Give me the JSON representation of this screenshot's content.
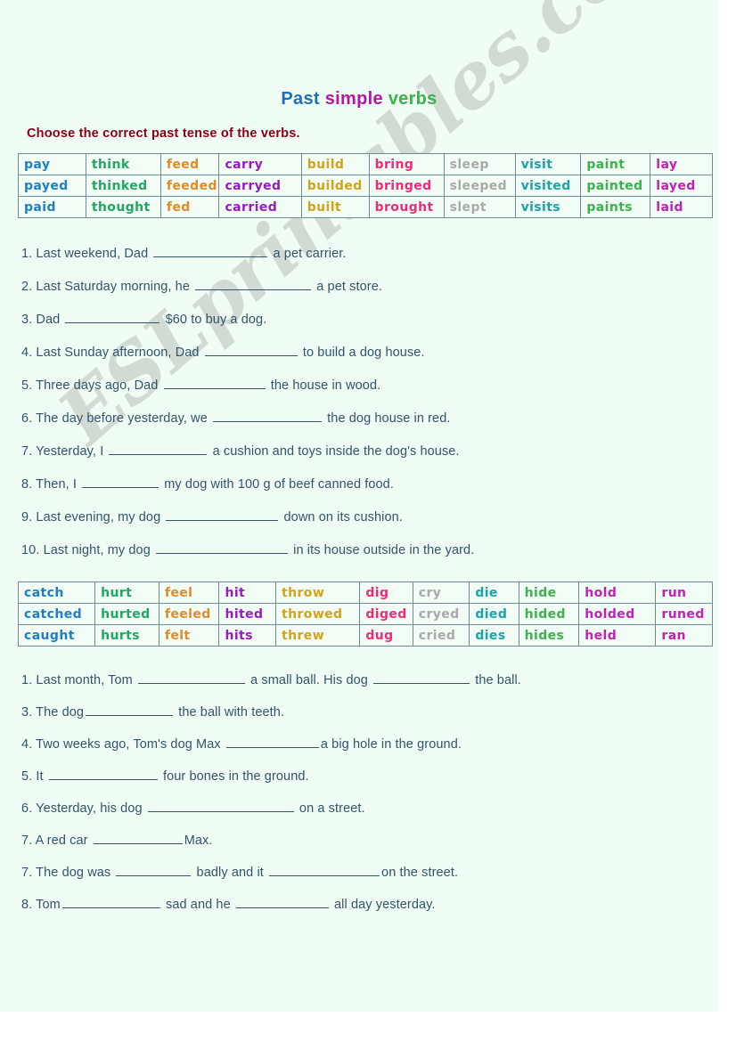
{
  "page": {
    "background_color": "#effdf4",
    "watermark": "ESLprintables.com"
  },
  "title": {
    "part1": "Past ",
    "part2": "simple ",
    "part3": "verbs",
    "color1": "#1f6fb8",
    "color2": "#b8159e",
    "color3": "#3ab34a"
  },
  "instruction": {
    "text": "Choose the correct past tense of the verbs.",
    "color": "#8c0016"
  },
  "table1": {
    "colors": [
      "#1f7fc4",
      "#1fa862",
      "#e08a2a",
      "#9b19c4",
      "#d2a316",
      "#ee2b7b",
      "#a9a9a9",
      "#1aa3a8",
      "#3ab34a",
      "#c41fb8"
    ],
    "widths": [
      74,
      82,
      64,
      90,
      74,
      82,
      78,
      72,
      76,
      68
    ],
    "rows": [
      [
        "pay",
        "think",
        "feed",
        "carry",
        "build",
        "bring",
        "sleep",
        "visit",
        "paint",
        "lay"
      ],
      [
        "payed",
        "thinked",
        "feeded",
        "carryed",
        "builded",
        "bringed",
        "sleeped",
        "visited",
        "painted",
        "layed"
      ],
      [
        "paid",
        "thought",
        "fed",
        "carried",
        "built",
        "brought",
        "slept",
        "visits",
        "paints",
        "laid"
      ]
    ]
  },
  "table2": {
    "colors": [
      "#1f7fc4",
      "#1fa862",
      "#e08a2a",
      "#9b19c4",
      "#d2a316",
      "#ee2b7b",
      "#a9a9a9",
      "#1aa3a8",
      "#3ab34a",
      "#c41fb8",
      "#c41fb8"
    ],
    "widths": [
      84,
      70,
      66,
      62,
      92,
      58,
      62,
      54,
      66,
      84,
      62
    ],
    "rows": [
      [
        "catch",
        "hurt",
        "feel",
        "hit",
        "throw",
        "dig",
        "cry",
        "die",
        "hide",
        "hold",
        "run"
      ],
      [
        "catched",
        "hurted",
        "feeled",
        "hited",
        "throwed",
        "diged",
        "cryed",
        "died",
        "hided",
        "holded",
        "runed"
      ],
      [
        "caught",
        "hurts",
        "felt",
        "hits",
        "threw",
        "dug",
        "cried",
        "dies",
        "hides",
        "held",
        "ran"
      ]
    ]
  },
  "exercises1": [
    {
      "pre": "1. Last weekend, Dad ",
      "blank": 128,
      "post": " a pet carrier."
    },
    {
      "pre": "2. Last Saturday morning, he ",
      "blank": 130,
      "post": " a pet store."
    },
    {
      "pre": "3. Dad ",
      "blank": 106,
      "post": " $60 to buy a dog."
    },
    {
      "pre": "4. Last Sunday afternoon, Dad ",
      "blank": 104,
      "post": " to build a dog house."
    },
    {
      "pre": "5. Three days ago, Dad ",
      "blank": 114,
      "post": " the house in wood."
    },
    {
      "pre": "6. The day before yesterday, we ",
      "blank": 122,
      "post": " the dog house in red."
    },
    {
      "pre": "7. Yesterday, I ",
      "blank": 110,
      "post": " a cushion and toys inside the dog's house."
    },
    {
      "pre": "8. Then, I ",
      "blank": 86,
      "post": " my dog with 100 g of beef canned food."
    },
    {
      "pre": "9. Last evening, my dog ",
      "blank": 126,
      "post": " down on its cushion."
    },
    {
      "pre": "10. Last night, my dog ",
      "blank": 148,
      "post": " in its house outside in the yard."
    }
  ],
  "exercises2": [
    {
      "pre": "1. Last month, Tom ",
      "blank": 120,
      "post": " a small ball. His dog ",
      "blank2": 108,
      "post2": " the ball."
    },
    {
      "pre": "3. The dog",
      "blank": 98,
      "post": "  the ball with teeth."
    },
    {
      "pre": "4. Two weeks ago, Tom's dog Max ",
      "blank": 104,
      "post": "a big hole in the ground."
    },
    {
      "pre": "5. It ",
      "blank": 122,
      "post": " four bones in the ground."
    },
    {
      "pre": "6. Yesterday, his dog ",
      "blank": 164,
      "post": " on a street."
    },
    {
      "pre": "7. A red car ",
      "blank": 100,
      "post": "Max."
    },
    {
      "pre": "7. The dog was ",
      "blank": 84,
      "post": " badly and it ",
      "blank2": 124,
      "post2": "on the street."
    },
    {
      "pre": "8. Tom",
      "blank": 110,
      "post": " sad and he ",
      "blank2": 104,
      "post2": " all day yesterday."
    }
  ]
}
